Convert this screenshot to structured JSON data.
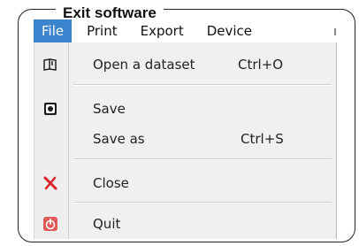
{
  "frame": {
    "title": "Exit software"
  },
  "menubar": {
    "items": [
      {
        "label": "File",
        "active": true
      },
      {
        "label": "Print"
      },
      {
        "label": "Export"
      },
      {
        "label": "Device"
      }
    ]
  },
  "file_menu": {
    "items": [
      {
        "label": "Open a dataset",
        "shortcut": "Ctrl+O",
        "icon": "open-book-icon"
      },
      {
        "label": "Save",
        "shortcut": "",
        "icon": "save-icon"
      },
      {
        "label": "Save as",
        "shortcut": "Ctrl+S",
        "icon": ""
      },
      {
        "label": "Close",
        "shortcut": "",
        "icon": "close-x-icon"
      },
      {
        "label": "Quit",
        "shortcut": "",
        "icon": "quit-power-icon"
      }
    ]
  },
  "colors": {
    "accent": "#3d84cf",
    "close_red": "#d8242d",
    "quit_red": "#e05a5a"
  }
}
